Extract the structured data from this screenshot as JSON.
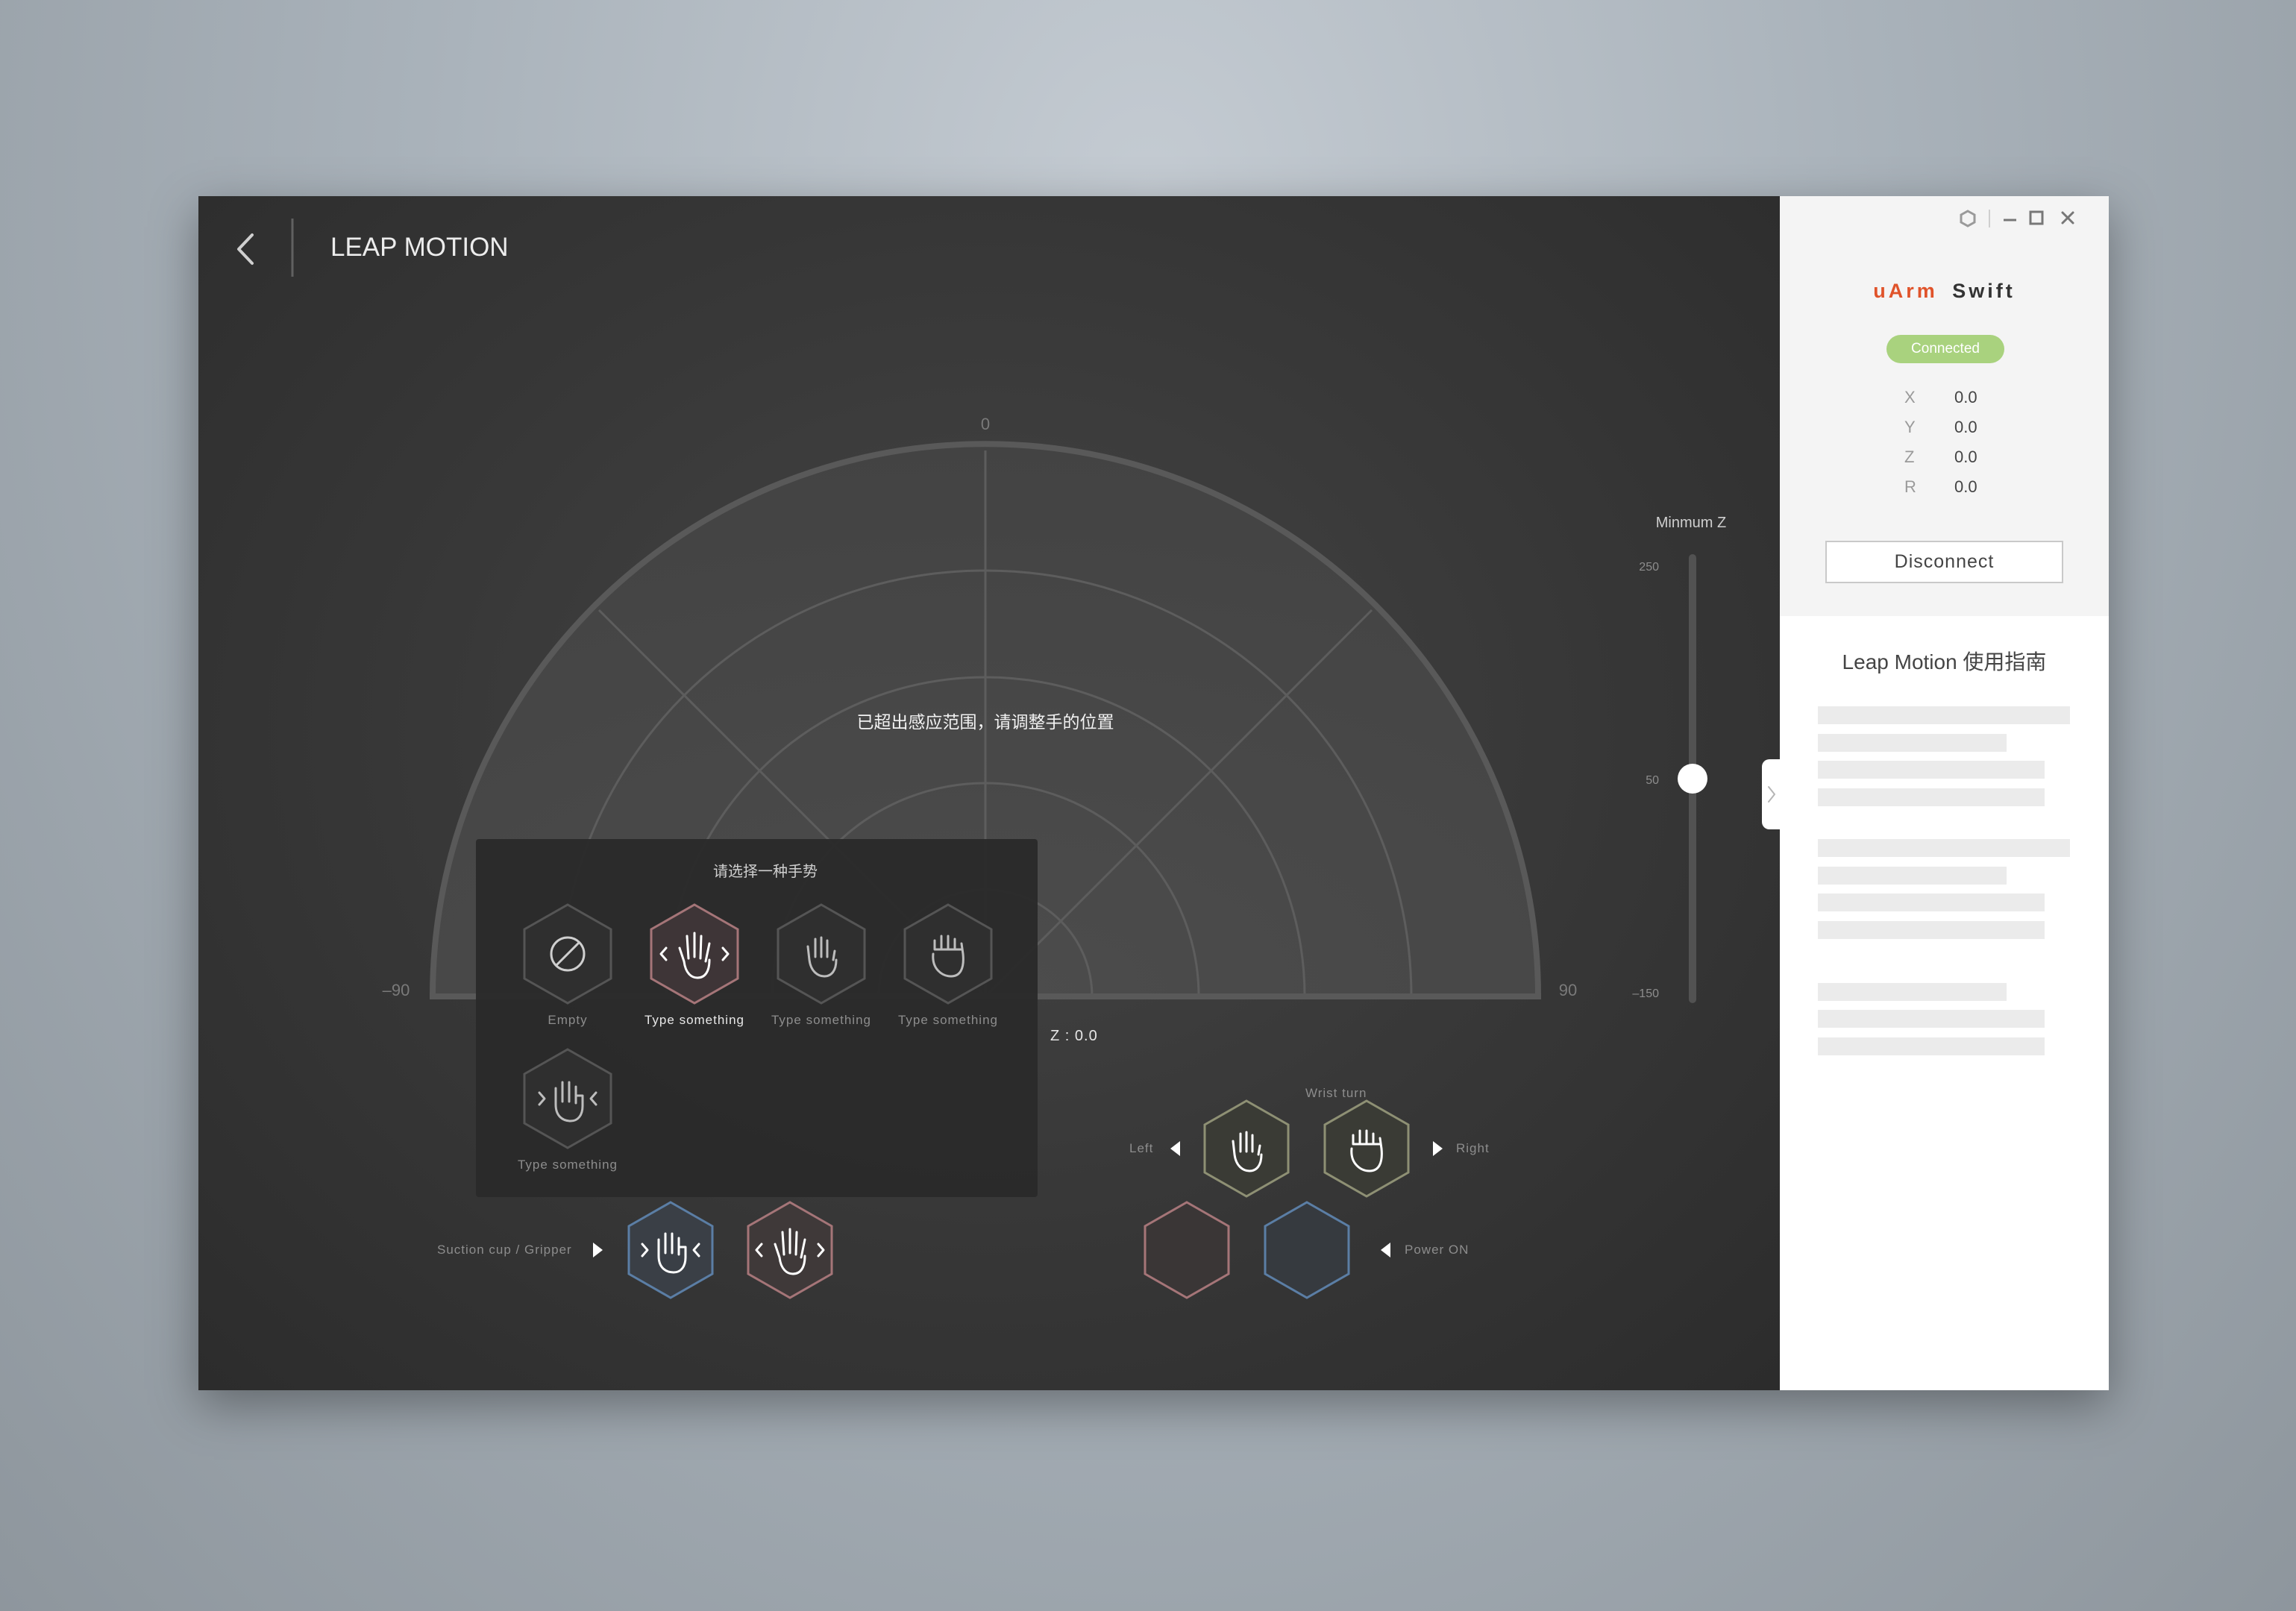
{
  "header": {
    "title": "LEAP MOTION"
  },
  "gauge": {
    "label_top": "0",
    "label_left": "–90",
    "label_right": "90",
    "warning": "已超出感应范围，请调整手的位置",
    "z_readout": "Z : 0.0"
  },
  "min_z": {
    "title": "Minmum Z",
    "tick_max": "250",
    "tick_mid": "50",
    "tick_min": "–150",
    "value": 50,
    "range": [
      -150,
      250
    ]
  },
  "gesture_popup": {
    "title": "请选择一种手势",
    "options": [
      {
        "label": "Empty",
        "icon": "empty-slash-icon",
        "selected": false
      },
      {
        "label": "Type something",
        "icon": "open-hand-swipe-icon",
        "selected": true
      },
      {
        "label": "Type something",
        "icon": "raised-hand-icon",
        "selected": false
      },
      {
        "label": "Type something",
        "icon": "fist-hand-icon",
        "selected": false
      },
      {
        "label": "Type something",
        "icon": "grab-hand-icon",
        "selected": false
      }
    ]
  },
  "controls": {
    "suction_label": "Suction cup / Gripper",
    "wrist_turn_label": "Wrist turn",
    "left_label": "Left",
    "right_label": "Right",
    "power_label": "Power ON"
  },
  "colors": {
    "accent_orange": "#e0532a",
    "connected_green": "#a9d27e",
    "hex_blue": "#5b7ea5",
    "hex_pink": "#a57578",
    "hex_olive": "#8e9074"
  },
  "sidebar": {
    "brand_part1": "uArm",
    "brand_part2": "Swift",
    "status": "Connected",
    "coords": [
      {
        "key": "X",
        "value": "0.0"
      },
      {
        "key": "Y",
        "value": "0.0"
      },
      {
        "key": "Z",
        "value": "0.0"
      },
      {
        "key": "R",
        "value": "0.0"
      }
    ],
    "disconnect_label": "Disconnect",
    "guide_title": "Leap Motion 使用指南"
  }
}
